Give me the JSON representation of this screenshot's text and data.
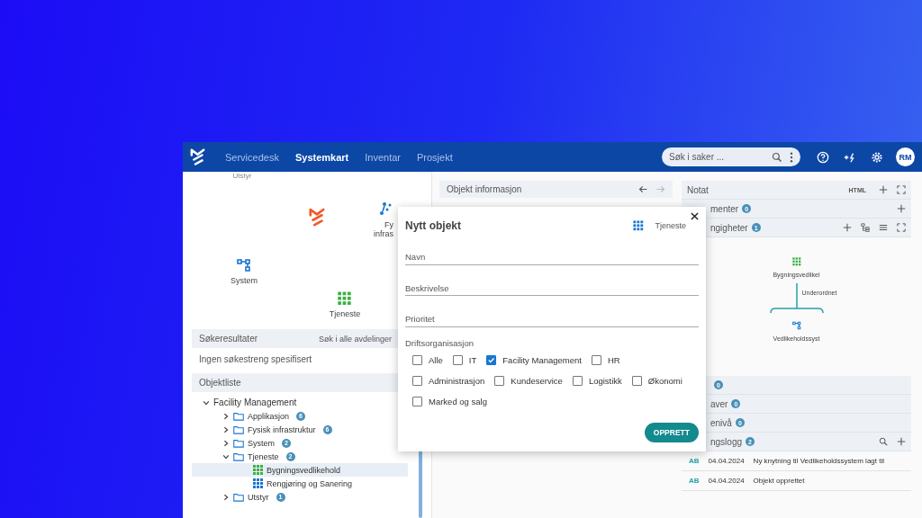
{
  "topbar": {
    "nav": [
      {
        "label": "Servicedesk",
        "selected": false
      },
      {
        "label": "Systemkart",
        "selected": true
      },
      {
        "label": "Inventar",
        "selected": false
      },
      {
        "label": "Prosjekt",
        "selected": false
      }
    ],
    "search": {
      "placeholder": "Søk i saker ..."
    },
    "avatar": "RM"
  },
  "canvas": {
    "nodes": [
      {
        "label": "Utstyr",
        "kind": "cut"
      },
      {
        "kind": "logo"
      },
      {
        "label": "Fy",
        "label_2": "infras",
        "kind": "infra"
      },
      {
        "label": "System",
        "kind": "system"
      },
      {
        "label": "Tjeneste",
        "kind": "service"
      }
    ]
  },
  "search_results": {
    "title": "Søkeresultater",
    "action": "Søk i alle avdelinger",
    "empty": "Ingen søkestreng spesifisert"
  },
  "object_list": {
    "title": "Objektliste",
    "tree": [
      {
        "label": "Facility Management",
        "kind": "group",
        "expanded": true,
        "children": [
          {
            "label": "Applikasjon",
            "kind": "folder",
            "count": "6",
            "expanded": false
          },
          {
            "label": "Fysisk infrastruktur",
            "kind": "folder",
            "count": "6",
            "expanded": false
          },
          {
            "label": "System",
            "kind": "folder",
            "count": "2",
            "expanded": false
          },
          {
            "label": "Tjeneste",
            "kind": "folder",
            "count": "2",
            "expanded": true,
            "children": [
              {
                "label": "Bygningsvedlikehold",
                "kind": "item",
                "color": "#3cb043",
                "selected": true
              },
              {
                "label": "Rengjøring og Sanering",
                "kind": "item",
                "color": "#1976d2",
                "selected": false
              }
            ]
          },
          {
            "label": "Utstyr",
            "kind": "folder",
            "count": "1",
            "expanded": false
          }
        ]
      }
    ]
  },
  "object_info": {
    "title": "Objekt informasjon"
  },
  "right_panel": {
    "sections": [
      {
        "label": "Notat",
        "kind": "notes",
        "html_label": "HTML"
      },
      {
        "label": "menter",
        "count": "0",
        "kind": "documents"
      },
      {
        "label": "ngigheter",
        "count": "1",
        "kind": "dependencies"
      }
    ],
    "dependency": {
      "parent": "Bygningsvedlikel",
      "relation": "Underordnet",
      "child": "Vedlikeholdssyst"
    },
    "sections_2": [
      {
        "count": "0",
        "kind": "plain"
      },
      {
        "label": "aver",
        "count": "0",
        "kind": "plain"
      },
      {
        "label": "enivå",
        "count": "0",
        "kind": "plain"
      },
      {
        "label": "ngslogg",
        "count": "2",
        "kind": "log"
      }
    ],
    "log": [
      {
        "user": "AB",
        "date": "04.04.2024",
        "text": "Ny knytning til Vedlikeholdssystem lagt til"
      },
      {
        "user": "AB",
        "date": "04.04.2024",
        "text": "Objekt opprettet"
      }
    ]
  },
  "dialog": {
    "title": "Nytt objekt",
    "type": "Tjeneste",
    "fields": [
      {
        "placeholder": "Navn",
        "kind": "line"
      },
      {
        "placeholder": "Beskrivelse",
        "kind": "area"
      },
      {
        "placeholder": "Prioritet",
        "kind": "line"
      }
    ],
    "group_label": "Driftsorganisasjon",
    "options": [
      {
        "label": "Alle",
        "checked": false
      },
      {
        "label": "IT",
        "checked": false
      },
      {
        "label": "Facility Management",
        "checked": true
      },
      {
        "label": "HR",
        "checked": false
      },
      {
        "label": "Administrasjon",
        "checked": false
      },
      {
        "label": "Kundeservice",
        "checked": false
      },
      {
        "label": "Logistikk",
        "checked": false
      },
      {
        "label": "Økonomi",
        "checked": false
      },
      {
        "label": "Marked og salg",
        "checked": false
      }
    ],
    "button": "OPPRETT"
  }
}
